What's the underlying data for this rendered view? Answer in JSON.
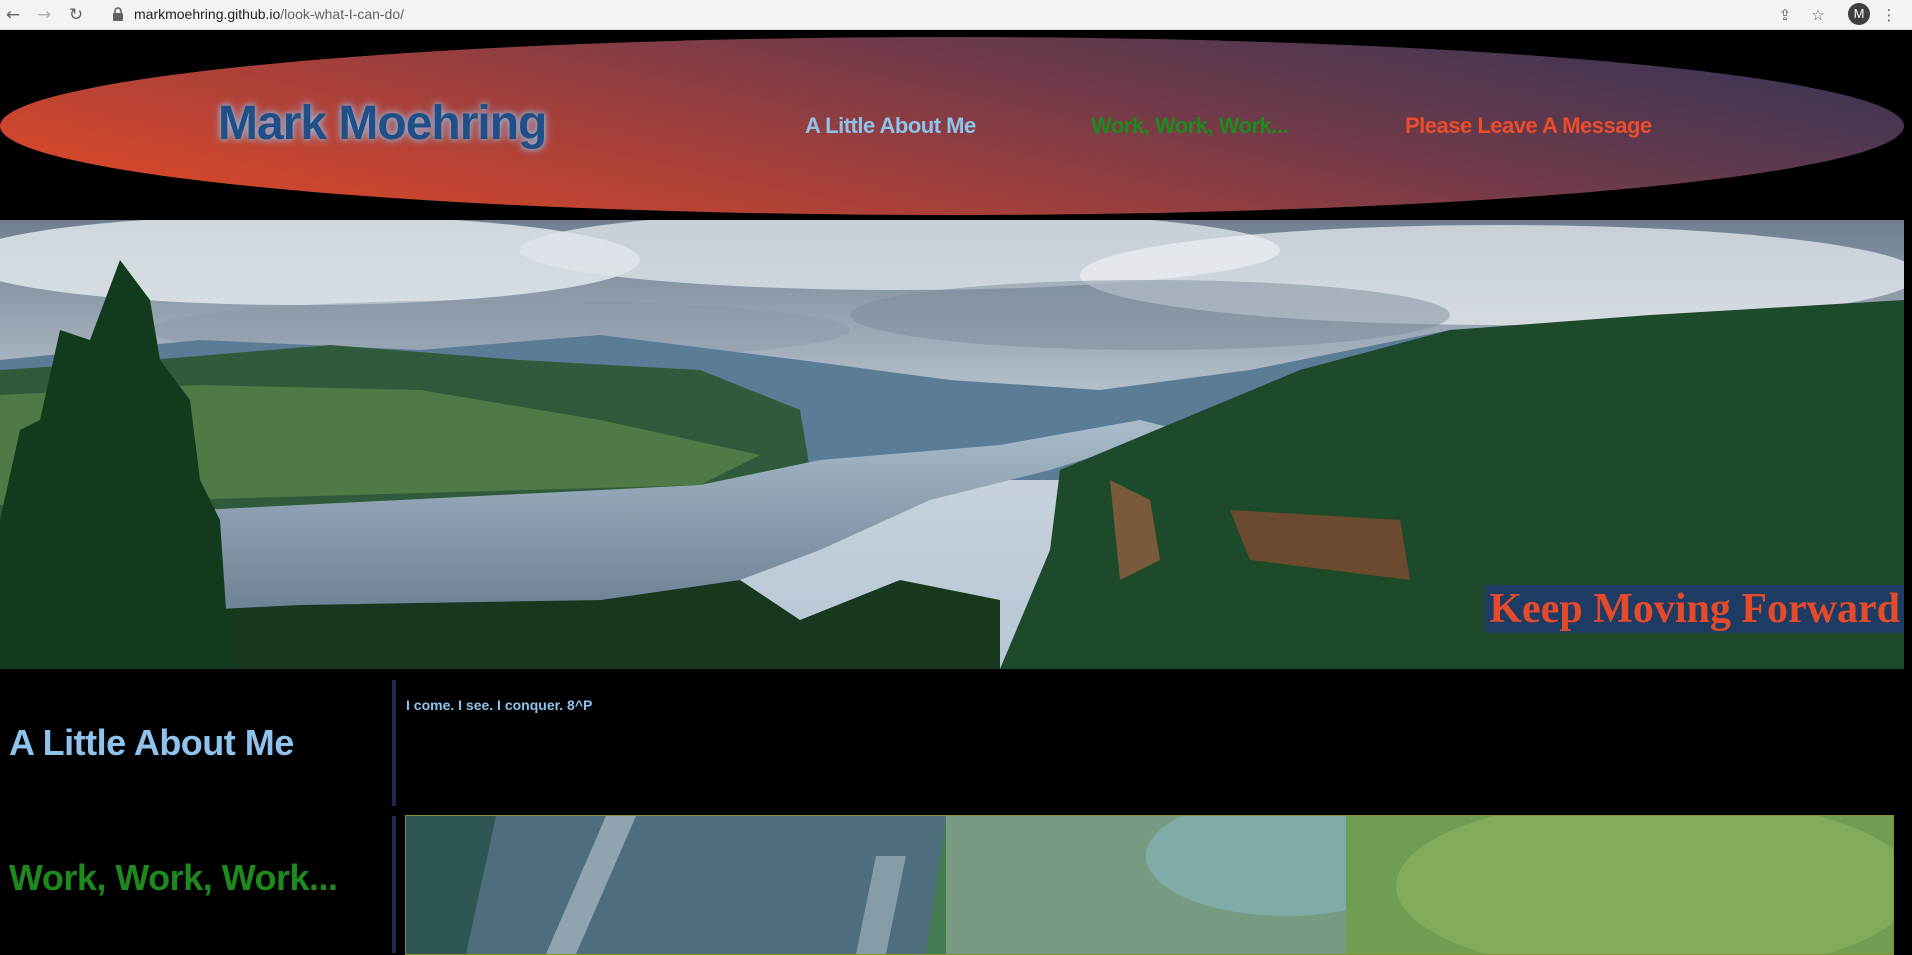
{
  "browser": {
    "url_host": "markmoehring.github.io",
    "url_path": "/look-what-I-can-do/",
    "profile_initial": "M"
  },
  "header": {
    "site_title": "Mark Moehring",
    "nav": [
      {
        "label": "A Little About Me",
        "color": "#8ec3ee"
      },
      {
        "label": "Work, Work, Work...",
        "color": "#1d8a1d"
      },
      {
        "label": "Please Leave A Message",
        "color": "#ec4c2a"
      }
    ]
  },
  "hero": {
    "tagline": "Keep Moving Forward"
  },
  "sections": {
    "about": {
      "heading": "A Little About Me",
      "text": "I come. I see. I conquer. 8^P"
    },
    "work": {
      "heading": "Work, Work, Work..."
    }
  },
  "colors": {
    "background": "#000000",
    "accent_blue": "#8ec3ee",
    "accent_green": "#1d8a1d",
    "accent_orange": "#ec4c2a"
  }
}
